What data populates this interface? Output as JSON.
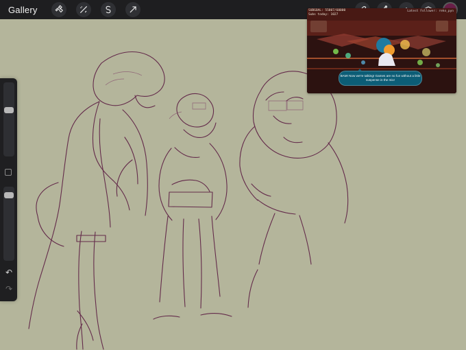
{
  "app": {
    "gallery_label": "Gallery"
  },
  "toolbar": {
    "tools": [
      {
        "name": "wrench-icon"
      },
      {
        "name": "magic-wand-icon"
      },
      {
        "name": "selection-s-icon"
      },
      {
        "name": "transform-arrow-icon"
      }
    ],
    "right_tools": [
      {
        "name": "brush-icon"
      },
      {
        "name": "smudge-icon"
      },
      {
        "name": "eraser-icon"
      },
      {
        "name": "layers-icon"
      }
    ],
    "current_color": "#6a1f48"
  },
  "sidebar": {
    "size_slider_value": 0.36,
    "opacity_slider_value": 0.08,
    "modify_button_icon": "square-icon",
    "undo_icon": "undo-icon",
    "redo_icon": "redo-icon"
  },
  "stream_overlay": {
    "subgoal": "SUBGOAL: 55807/60000",
    "subs_today": "Subs today: 1027",
    "latest_follower": "Latest Follower: reko_pyn",
    "dialogue": "BAM! Now we're talking! Games are no fun without a little suspense in the mix!"
  },
  "canvas": {
    "background": "#b4b59b",
    "stroke_color": "#5f2346"
  }
}
